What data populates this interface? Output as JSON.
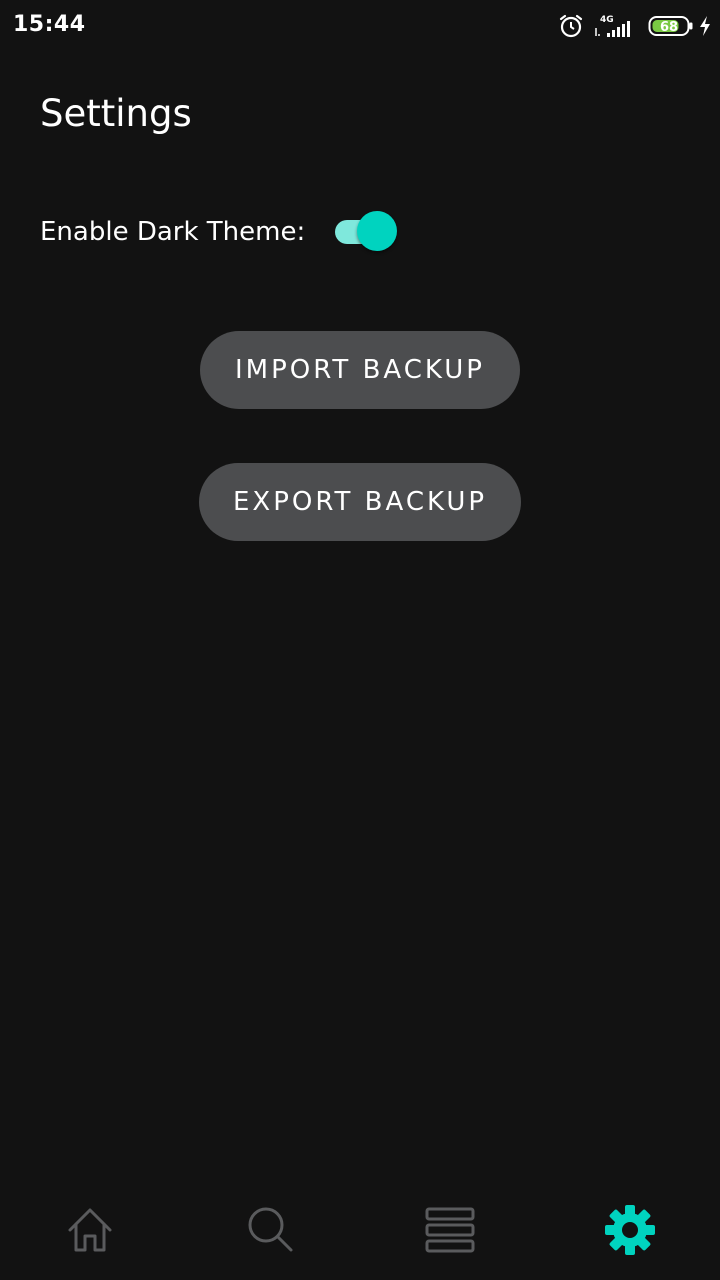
{
  "status_bar": {
    "time": "15:44",
    "network_type": "4G",
    "battery_level": "68",
    "icons": [
      "alarm-icon",
      "signal-icon",
      "battery-icon",
      "charging-icon"
    ]
  },
  "page": {
    "title": "Settings"
  },
  "settings": {
    "dark_theme_label": "Enable Dark Theme:",
    "dark_theme_enabled": true
  },
  "buttons": {
    "import_label": "IMPORT BACKUP",
    "export_label": "EXPORT BACKUP"
  },
  "bottom_nav": {
    "items": [
      {
        "icon": "home-icon",
        "active": false
      },
      {
        "icon": "search-icon",
        "active": false
      },
      {
        "icon": "list-icon",
        "active": false
      },
      {
        "icon": "gear-icon",
        "active": true
      }
    ]
  },
  "colors": {
    "background": "#121212",
    "accent": "#00d3bf",
    "accent_track": "#7fe8dc",
    "button_bg": "#4c4d4f",
    "inactive_icon": "#5a5b5d"
  }
}
